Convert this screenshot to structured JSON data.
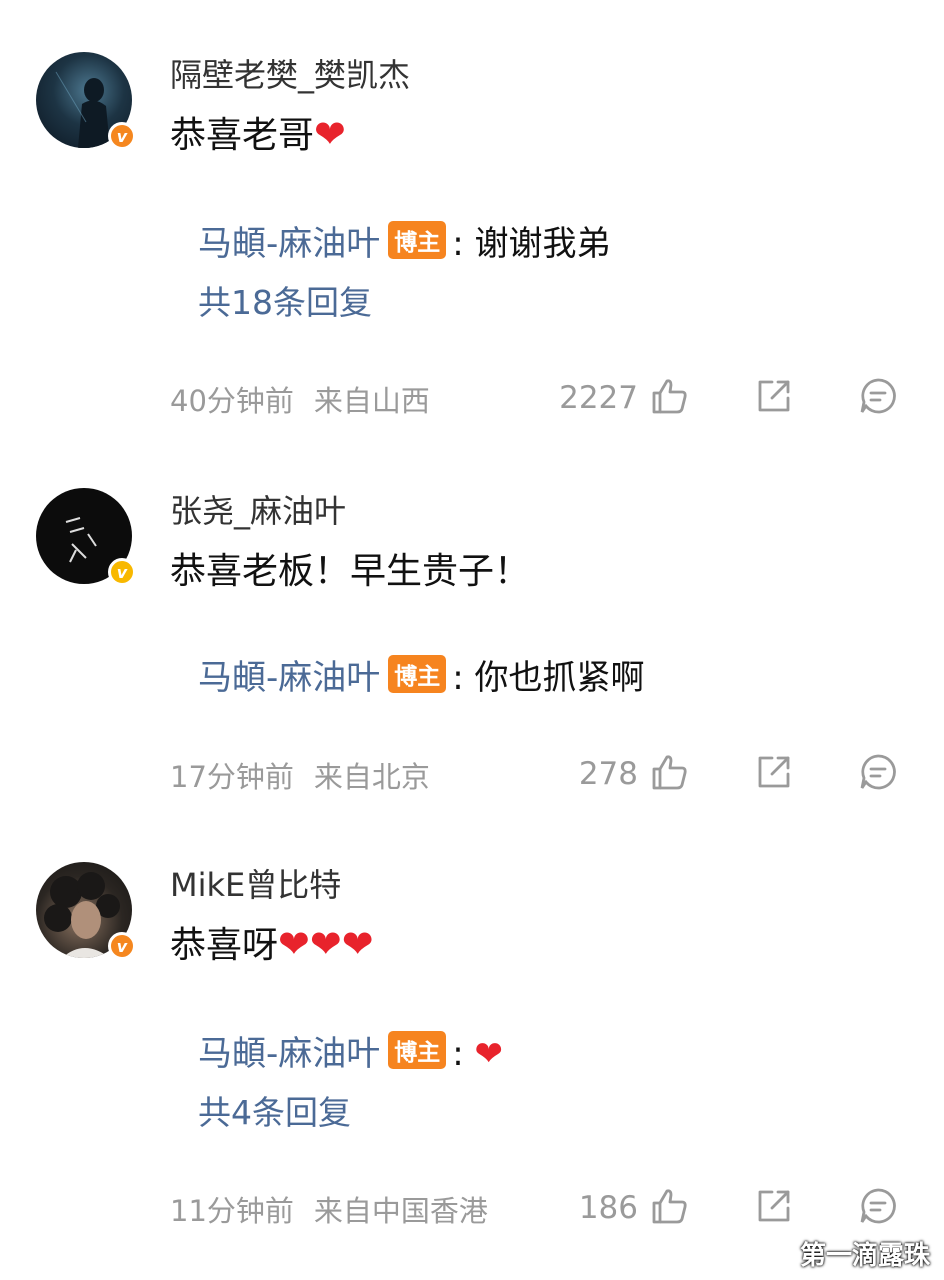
{
  "comments": [
    {
      "username": "隔壁老樊_樊凯杰",
      "content": "恭喜老哥",
      "hearts": "❤",
      "reply": {
        "author": "马頔-麻油叶",
        "badge": "博主",
        "text": ": 谢谢我弟"
      },
      "more_replies": "共18条回复",
      "time": "40分钟前",
      "location": "来自山西",
      "likes": "2227"
    },
    {
      "username": "张尧_麻油叶",
      "content": "恭喜老板！早生贵子！",
      "hearts": "",
      "reply": {
        "author": "马頔-麻油叶",
        "badge": "博主",
        "text": ": 你也抓紧啊"
      },
      "more_replies": "",
      "time": "17分钟前",
      "location": "来自北京",
      "likes": "278"
    },
    {
      "username": "MikE曾比特",
      "content": "恭喜呀",
      "hearts": "❤❤❤",
      "reply": {
        "author": "马頔-麻油叶",
        "badge": "博主",
        "text": ": ❤"
      },
      "more_replies": "共4条回复",
      "time": "11分钟前",
      "location": "来自中国香港",
      "likes": "186"
    }
  ],
  "icons": {
    "like": "thumbs-up-icon",
    "share": "share-icon",
    "comment": "comment-icon"
  },
  "colors": {
    "link": "#4b6a96",
    "badge": "#f6841f",
    "heart": "#e8232c",
    "verified_orange": "#f5871f",
    "verified_gold": "#f8b800"
  },
  "watermark": "第一滴露珠"
}
